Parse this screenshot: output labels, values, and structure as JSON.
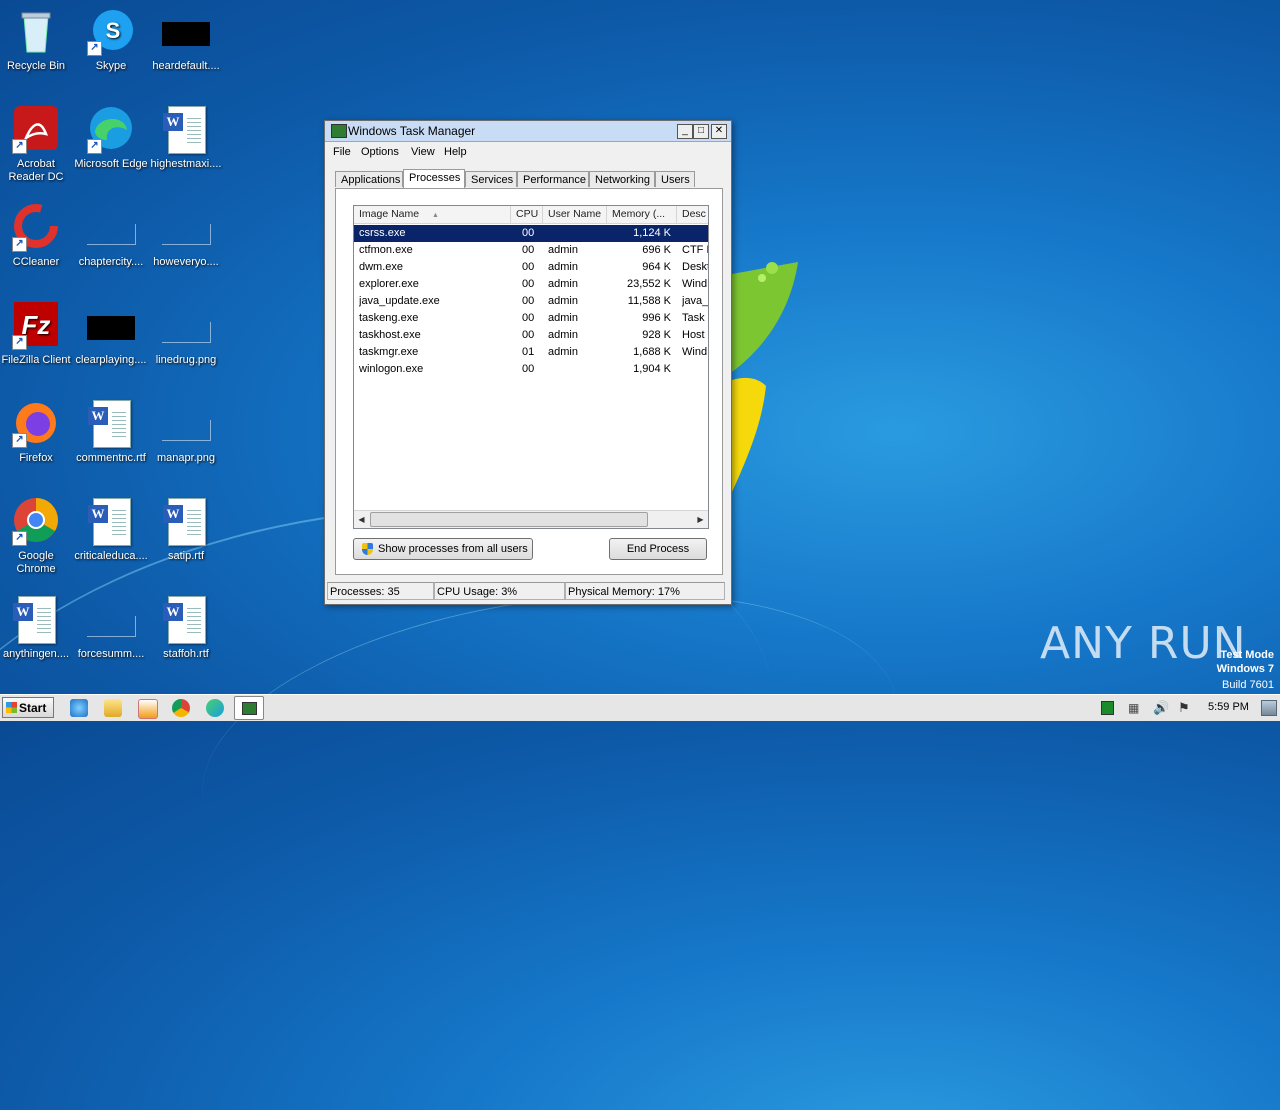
{
  "desktop": {
    "icons": [
      {
        "label": "Recycle Bin"
      },
      {
        "label": "Skype"
      },
      {
        "label": "heardefault...."
      },
      {
        "label": "Acrobat Reader DC"
      },
      {
        "label": "Microsoft Edge"
      },
      {
        "label": "highestmaxi...."
      },
      {
        "label": "CCleaner"
      },
      {
        "label": "chaptercity...."
      },
      {
        "label": "howeveryo...."
      },
      {
        "label": "FileZilla Client"
      },
      {
        "label": "clearplaying...."
      },
      {
        "label": "linedrug.png"
      },
      {
        "label": "Firefox"
      },
      {
        "label": "commentnc.rtf"
      },
      {
        "label": "manapr.png"
      },
      {
        "label": "Google Chrome"
      },
      {
        "label": "criticaleduca...."
      },
      {
        "label": "satip.rtf"
      },
      {
        "label": "anythingen...."
      },
      {
        "label": "forcesumm...."
      },
      {
        "label": "staffoh.rtf"
      }
    ]
  },
  "window": {
    "title": "Windows Task Manager",
    "menu": [
      "File",
      "Options",
      "View",
      "Help"
    ],
    "tabs": [
      "Applications",
      "Processes",
      "Services",
      "Performance",
      "Networking",
      "Users"
    ],
    "active_tab": "Processes",
    "columns": [
      "Image Name",
      "CPU",
      "User Name",
      "Memory (...",
      "Desc"
    ],
    "rows": [
      {
        "name": "csrss.exe",
        "cpu": "00",
        "user": "",
        "mem": "1,124 K",
        "desc": ""
      },
      {
        "name": "ctfmon.exe",
        "cpu": "00",
        "user": "admin",
        "mem": "696 K",
        "desc": "CTF L"
      },
      {
        "name": "dwm.exe",
        "cpu": "00",
        "user": "admin",
        "mem": "964 K",
        "desc": "Deskt"
      },
      {
        "name": "explorer.exe",
        "cpu": "00",
        "user": "admin",
        "mem": "23,552 K",
        "desc": "Wind"
      },
      {
        "name": "java_update.exe",
        "cpu": "00",
        "user": "admin",
        "mem": "11,588 K",
        "desc": "java_"
      },
      {
        "name": "taskeng.exe",
        "cpu": "00",
        "user": "admin",
        "mem": "996 K",
        "desc": "Task"
      },
      {
        "name": "taskhost.exe",
        "cpu": "00",
        "user": "admin",
        "mem": "928 K",
        "desc": "Host"
      },
      {
        "name": "taskmgr.exe",
        "cpu": "01",
        "user": "admin",
        "mem": "1,688 K",
        "desc": "Wind"
      },
      {
        "name": "winlogon.exe",
        "cpu": "00",
        "user": "",
        "mem": "1,904 K",
        "desc": ""
      }
    ],
    "show_all_label": "Show processes from all users",
    "end_process_label": "End Process",
    "status": {
      "processes": "Processes: 35",
      "cpu": "CPU Usage: 3%",
      "memory": "Physical Memory: 17%"
    }
  },
  "taskbar": {
    "start_label": "Start",
    "clock": "5:59 PM"
  },
  "watermark": {
    "line1": "Test Mode",
    "line2": "Windows 7",
    "line3": "Build 7601",
    "brand": "ANY RUN"
  }
}
